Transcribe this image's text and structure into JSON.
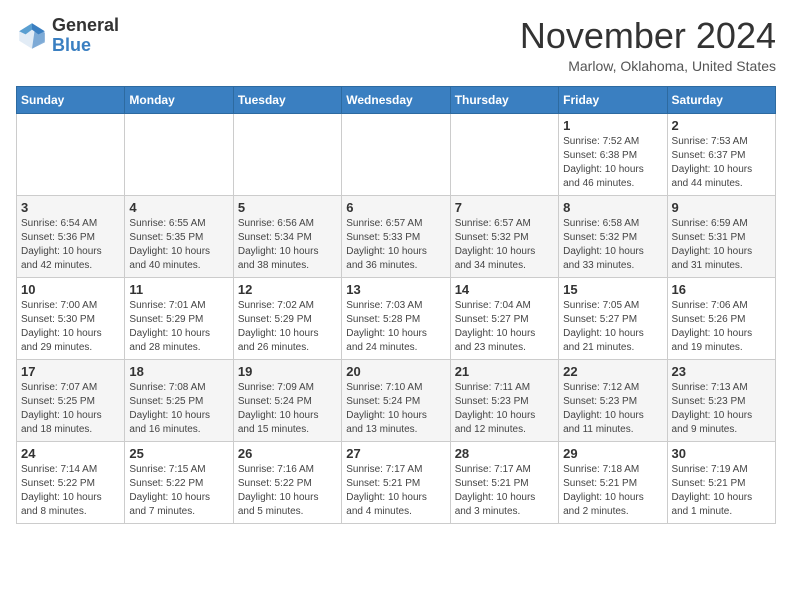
{
  "header": {
    "logo_line1": "General",
    "logo_line2": "Blue",
    "month": "November 2024",
    "location": "Marlow, Oklahoma, United States"
  },
  "weekdays": [
    "Sunday",
    "Monday",
    "Tuesday",
    "Wednesday",
    "Thursday",
    "Friday",
    "Saturday"
  ],
  "weeks": [
    [
      {
        "day": "",
        "info": ""
      },
      {
        "day": "",
        "info": ""
      },
      {
        "day": "",
        "info": ""
      },
      {
        "day": "",
        "info": ""
      },
      {
        "day": "",
        "info": ""
      },
      {
        "day": "1",
        "info": "Sunrise: 7:52 AM\nSunset: 6:38 PM\nDaylight: 10 hours and 46 minutes."
      },
      {
        "day": "2",
        "info": "Sunrise: 7:53 AM\nSunset: 6:37 PM\nDaylight: 10 hours and 44 minutes."
      }
    ],
    [
      {
        "day": "3",
        "info": "Sunrise: 6:54 AM\nSunset: 5:36 PM\nDaylight: 10 hours and 42 minutes."
      },
      {
        "day": "4",
        "info": "Sunrise: 6:55 AM\nSunset: 5:35 PM\nDaylight: 10 hours and 40 minutes."
      },
      {
        "day": "5",
        "info": "Sunrise: 6:56 AM\nSunset: 5:34 PM\nDaylight: 10 hours and 38 minutes."
      },
      {
        "day": "6",
        "info": "Sunrise: 6:57 AM\nSunset: 5:33 PM\nDaylight: 10 hours and 36 minutes."
      },
      {
        "day": "7",
        "info": "Sunrise: 6:57 AM\nSunset: 5:32 PM\nDaylight: 10 hours and 34 minutes."
      },
      {
        "day": "8",
        "info": "Sunrise: 6:58 AM\nSunset: 5:32 PM\nDaylight: 10 hours and 33 minutes."
      },
      {
        "day": "9",
        "info": "Sunrise: 6:59 AM\nSunset: 5:31 PM\nDaylight: 10 hours and 31 minutes."
      }
    ],
    [
      {
        "day": "10",
        "info": "Sunrise: 7:00 AM\nSunset: 5:30 PM\nDaylight: 10 hours and 29 minutes."
      },
      {
        "day": "11",
        "info": "Sunrise: 7:01 AM\nSunset: 5:29 PM\nDaylight: 10 hours and 28 minutes."
      },
      {
        "day": "12",
        "info": "Sunrise: 7:02 AM\nSunset: 5:29 PM\nDaylight: 10 hours and 26 minutes."
      },
      {
        "day": "13",
        "info": "Sunrise: 7:03 AM\nSunset: 5:28 PM\nDaylight: 10 hours and 24 minutes."
      },
      {
        "day": "14",
        "info": "Sunrise: 7:04 AM\nSunset: 5:27 PM\nDaylight: 10 hours and 23 minutes."
      },
      {
        "day": "15",
        "info": "Sunrise: 7:05 AM\nSunset: 5:27 PM\nDaylight: 10 hours and 21 minutes."
      },
      {
        "day": "16",
        "info": "Sunrise: 7:06 AM\nSunset: 5:26 PM\nDaylight: 10 hours and 19 minutes."
      }
    ],
    [
      {
        "day": "17",
        "info": "Sunrise: 7:07 AM\nSunset: 5:25 PM\nDaylight: 10 hours and 18 minutes."
      },
      {
        "day": "18",
        "info": "Sunrise: 7:08 AM\nSunset: 5:25 PM\nDaylight: 10 hours and 16 minutes."
      },
      {
        "day": "19",
        "info": "Sunrise: 7:09 AM\nSunset: 5:24 PM\nDaylight: 10 hours and 15 minutes."
      },
      {
        "day": "20",
        "info": "Sunrise: 7:10 AM\nSunset: 5:24 PM\nDaylight: 10 hours and 13 minutes."
      },
      {
        "day": "21",
        "info": "Sunrise: 7:11 AM\nSunset: 5:23 PM\nDaylight: 10 hours and 12 minutes."
      },
      {
        "day": "22",
        "info": "Sunrise: 7:12 AM\nSunset: 5:23 PM\nDaylight: 10 hours and 11 minutes."
      },
      {
        "day": "23",
        "info": "Sunrise: 7:13 AM\nSunset: 5:23 PM\nDaylight: 10 hours and 9 minutes."
      }
    ],
    [
      {
        "day": "24",
        "info": "Sunrise: 7:14 AM\nSunset: 5:22 PM\nDaylight: 10 hours and 8 minutes."
      },
      {
        "day": "25",
        "info": "Sunrise: 7:15 AM\nSunset: 5:22 PM\nDaylight: 10 hours and 7 minutes."
      },
      {
        "day": "26",
        "info": "Sunrise: 7:16 AM\nSunset: 5:22 PM\nDaylight: 10 hours and 5 minutes."
      },
      {
        "day": "27",
        "info": "Sunrise: 7:17 AM\nSunset: 5:21 PM\nDaylight: 10 hours and 4 minutes."
      },
      {
        "day": "28",
        "info": "Sunrise: 7:17 AM\nSunset: 5:21 PM\nDaylight: 10 hours and 3 minutes."
      },
      {
        "day": "29",
        "info": "Sunrise: 7:18 AM\nSunset: 5:21 PM\nDaylight: 10 hours and 2 minutes."
      },
      {
        "day": "30",
        "info": "Sunrise: 7:19 AM\nSunset: 5:21 PM\nDaylight: 10 hours and 1 minute."
      }
    ]
  ]
}
